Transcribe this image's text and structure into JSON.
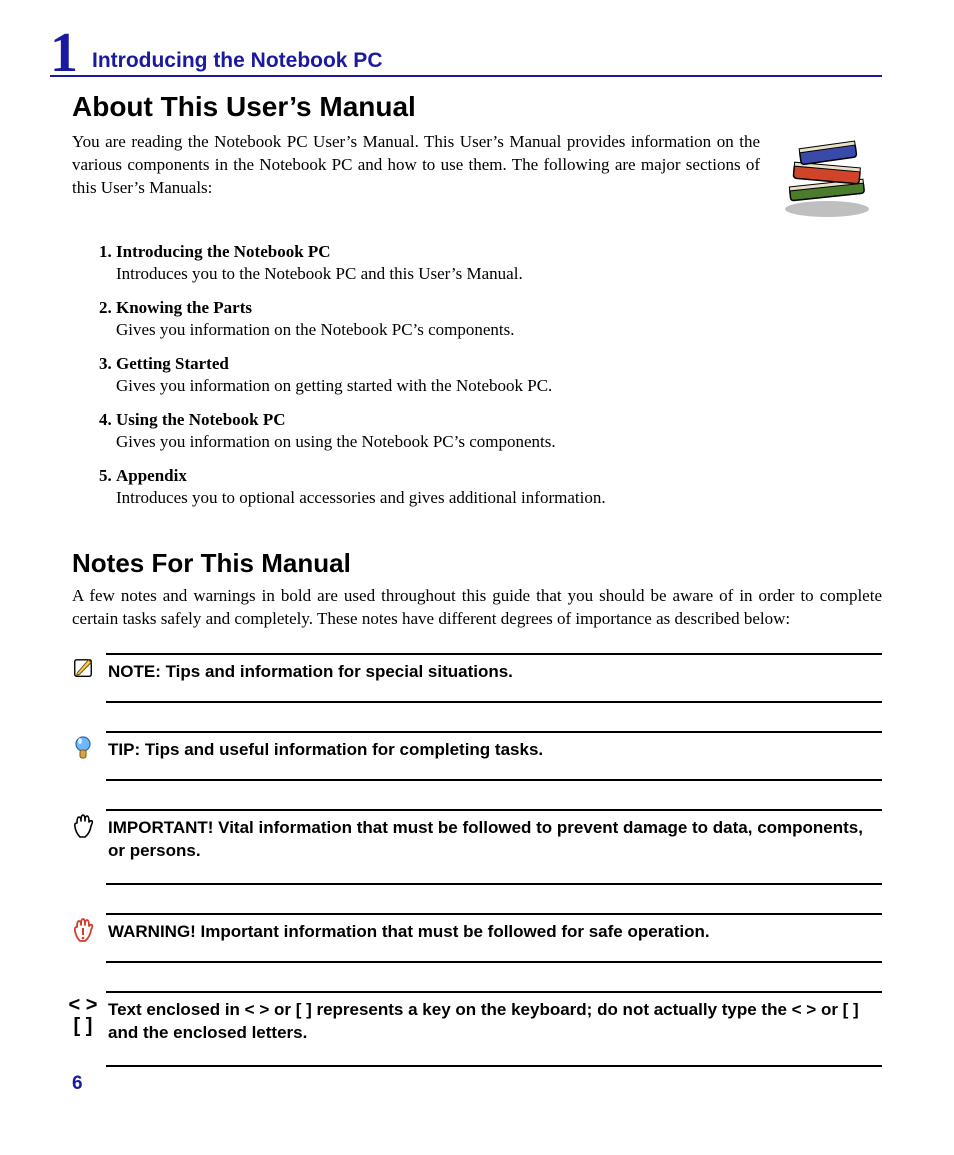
{
  "chapter": {
    "number": "1",
    "title": "Introducing the Notebook PC"
  },
  "about": {
    "heading": "About This User’s Manual",
    "intro": "You are reading the Notebook PC User’s Manual. This User’s Manual provides information on the various components in the Notebook PC and how to use them. The following are major sections of this User’s Manuals:",
    "sections": [
      {
        "title": "Introducing the Notebook PC",
        "desc": "Introduces you to the Notebook PC and this User’s Manual."
      },
      {
        "title": "Knowing the Parts",
        "desc": "Gives you information on the Notebook PC’s components."
      },
      {
        "title": "Getting Started",
        "desc": "Gives you information on getting started with the Notebook PC."
      },
      {
        "title": "Using the Notebook PC",
        "desc": "Gives you information on using the Notebook PC’s components."
      },
      {
        "title": "Appendix",
        "desc": "Introduces you to optional accessories and gives additional information."
      }
    ]
  },
  "notes": {
    "heading": "Notes For This Manual",
    "intro": "A few notes and warnings in bold are used throughout this guide that you should be aware of in order to complete certain tasks safely and completely. These notes have different degrees of importance as described below:",
    "callouts": {
      "note": "NOTE: Tips and information for special situations.",
      "tip": "TIP: Tips and useful information for completing tasks.",
      "important": "IMPORTANT! Vital information that must be followed to prevent damage to data, components, or persons.",
      "warning": "WARNING! Important information that must be followed for safe operation.",
      "keys": "Text enclosed in < > or [ ] represents a key on the keyboard; do not actually type the < > or [ ] and the enclosed letters."
    },
    "key_symbols": {
      "angle": "< >",
      "bracket": "[  ]"
    }
  },
  "page_number": "6"
}
